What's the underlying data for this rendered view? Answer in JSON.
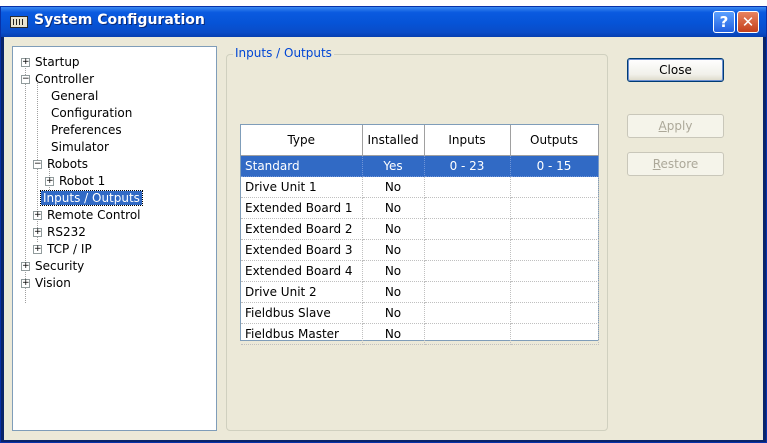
{
  "window": {
    "title": "System Configuration",
    "icon": "app-icon",
    "help_glyph": "?",
    "close_glyph": "✕",
    "colors": {
      "titlebar": "#0653d6",
      "selection": "#316ac5",
      "group_title": "#0046d5"
    }
  },
  "tree": {
    "items": [
      {
        "label": "Startup",
        "expander": "+"
      },
      {
        "label": "Controller",
        "expander": "−"
      },
      {
        "label": "General"
      },
      {
        "label": "Configuration"
      },
      {
        "label": "Preferences"
      },
      {
        "label": "Simulator"
      },
      {
        "label": "Robots",
        "expander": "−"
      },
      {
        "label": "Robot 1",
        "expander": "+"
      },
      {
        "label": "Inputs / Outputs",
        "selected": true
      },
      {
        "label": "Remote Control",
        "expander": "+"
      },
      {
        "label": "RS232",
        "expander": "+"
      },
      {
        "label": "TCP / IP",
        "expander": "+"
      },
      {
        "label": "Security",
        "expander": "+"
      },
      {
        "label": "Vision",
        "expander": "+"
      }
    ]
  },
  "panel": {
    "title": "Inputs / Outputs",
    "table": {
      "headers": [
        "Type",
        "Installed",
        "Inputs",
        "Outputs"
      ],
      "rows": [
        {
          "type": "Standard",
          "installed": "Yes",
          "inputs": "0 - 23",
          "outputs": "0 - 15",
          "selected": true
        },
        {
          "type": "Drive Unit 1",
          "installed": "No",
          "inputs": "",
          "outputs": ""
        },
        {
          "type": "Extended Board 1",
          "installed": "No",
          "inputs": "",
          "outputs": ""
        },
        {
          "type": "Extended Board 2",
          "installed": "No",
          "inputs": "",
          "outputs": ""
        },
        {
          "type": "Extended Board 3",
          "installed": "No",
          "inputs": "",
          "outputs": ""
        },
        {
          "type": "Extended Board 4",
          "installed": "No",
          "inputs": "",
          "outputs": ""
        },
        {
          "type": "Drive Unit 2",
          "installed": "No",
          "inputs": "",
          "outputs": ""
        },
        {
          "type": "Fieldbus Slave",
          "installed": "No",
          "inputs": "",
          "outputs": ""
        },
        {
          "type": "Fieldbus Master",
          "installed": "No",
          "inputs": "",
          "outputs": ""
        }
      ]
    }
  },
  "buttons": {
    "close": "Close",
    "apply_first": "A",
    "apply_rest": "pply",
    "restore_first": "R",
    "restore_rest": "estore",
    "apply_enabled": false,
    "restore_enabled": false
  }
}
